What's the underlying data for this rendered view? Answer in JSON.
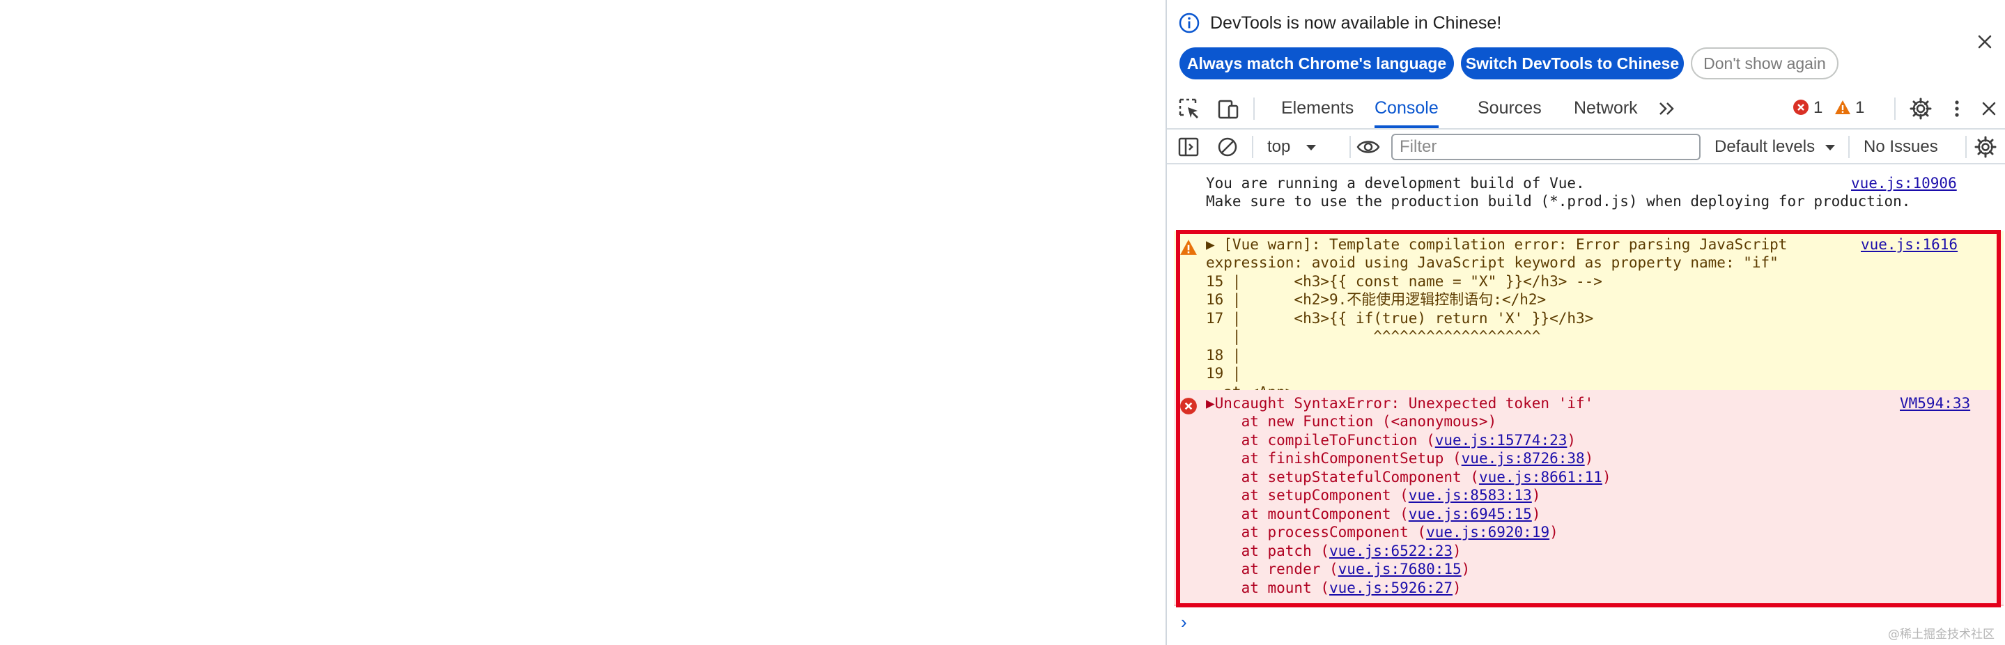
{
  "infobar": {
    "message": "DevTools is now available in Chinese!",
    "btn_match": "Always match Chrome's language",
    "btn_switch": "Switch DevTools to Chinese",
    "btn_dont": "Don't show again"
  },
  "tabs": {
    "items": [
      "Elements",
      "Console",
      "Sources",
      "Network"
    ],
    "active": "Console",
    "overflow": "»",
    "error_count": "1",
    "warning_count": "1"
  },
  "toolbar": {
    "context": "top",
    "filter_placeholder": "Filter",
    "levels": "Default levels",
    "issues": "No Issues"
  },
  "messages": {
    "info": {
      "line1": "You are running a development build of Vue.",
      "line2": "Make sure to use the production build (*.prod.js) when deploying for production.",
      "source": "vue.js:10906"
    },
    "warning": {
      "line1": "▶ [Vue warn]: Template compilation error: Error parsing JavaScript",
      "line2": "expression: avoid using JavaScript keyword as property name: \"if\"",
      "line3": "15 |      <h3>{{ const name = \"X\" }}</h3> -->",
      "line4": "16 |      <h2>9.不能使用逻辑控制语句:</h2>",
      "line5": "17 |      <h3>{{ if(true) return 'X' }}</h3>",
      "line6": "   |               ^^^^^^^^^^^^^^^^^^^",
      "line7": "18 |",
      "line8": "19 |",
      "line9": "  at <App>",
      "source": "vue.js:1616"
    },
    "error": {
      "title": "▶Uncaught SyntaxError: Unexpected token 'if'",
      "source": "VM594:33",
      "frames": [
        {
          "fn": "    at new Function (<anonymous>)",
          "link": ""
        },
        {
          "fn": "    at compileToFunction (",
          "link": "vue.js:15774:23"
        },
        {
          "fn": "    at finishComponentSetup (",
          "link": "vue.js:8726:38"
        },
        {
          "fn": "    at setupStatefulComponent (",
          "link": "vue.js:8661:11"
        },
        {
          "fn": "    at setupComponent (",
          "link": "vue.js:8583:13"
        },
        {
          "fn": "    at mountComponent (",
          "link": "vue.js:6945:15"
        },
        {
          "fn": "    at processComponent (",
          "link": "vue.js:6920:19"
        },
        {
          "fn": "    at patch (",
          "link": "vue.js:6522:23"
        },
        {
          "fn": "    at render (",
          "link": "vue.js:7680:15"
        },
        {
          "fn": "    at mount (",
          "link": "vue.js:5926:27"
        }
      ]
    },
    "prompt": "›"
  },
  "watermark": "@稀土掘金技术社区",
  "colors": {
    "accent": "#0b57d0",
    "warning_bg": "#fffbd6",
    "error_bg": "#fde7e7",
    "highlight_frame": "#e3001b"
  }
}
